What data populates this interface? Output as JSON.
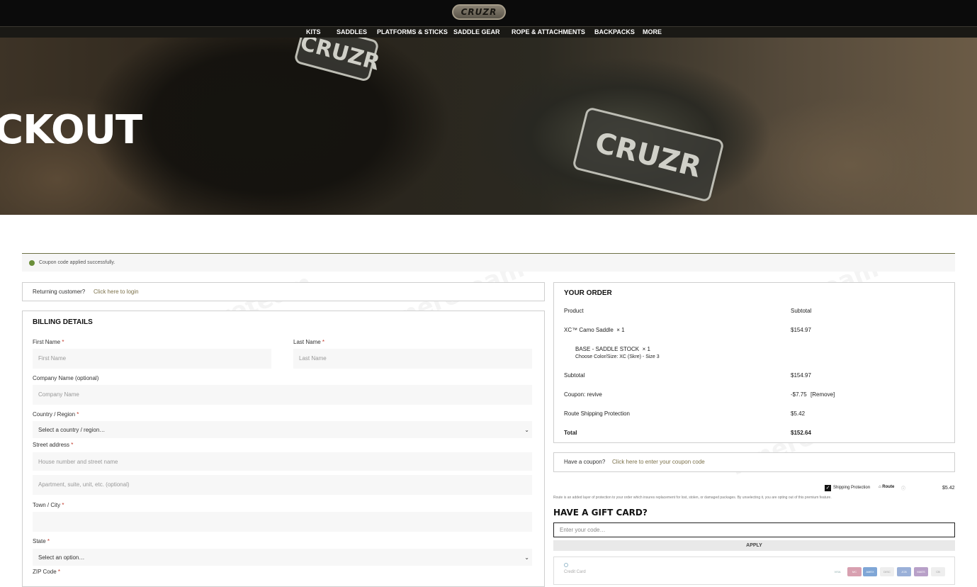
{
  "header": {
    "logo_text": "CRUZR",
    "nav": [
      "KITS",
      "SADDLES",
      "PLATFORMS & STICKS",
      "SADDLE GEAR",
      "ROPE & ATTACHMENTS",
      "BACKPACKS",
      "MORE"
    ]
  },
  "hero": {
    "title": "CKOUT",
    "badge_text": "CRUZR"
  },
  "notice": {
    "text": "Coupon code applied successfully."
  },
  "returning": {
    "text": "Returning customer?",
    "link": "Click here to login"
  },
  "billing": {
    "heading": "BILLING DETAILS",
    "first_name_label": "First Name",
    "first_name_placeholder": "First Name",
    "last_name_label": "Last Name",
    "last_name_placeholder": "Last Name",
    "company_label": "Company Name (optional)",
    "company_placeholder": "Company Name",
    "country_label": "Country / Region",
    "country_value": "Select a country / region…",
    "street_label": "Street address",
    "street_placeholder": "House number and street name",
    "apt_placeholder": "Apartment, suite, unit, etc. (optional)",
    "city_label": "Town / City",
    "state_label": "State",
    "state_value": "Select an option…",
    "zip_label": "ZIP Code",
    "required_mark": "*"
  },
  "order": {
    "heading": "YOUR ORDER",
    "col_product": "Product",
    "col_subtotal": "Subtotal",
    "item_name": "XC™ Camo Saddle",
    "item_qty": "× 1",
    "item_price": "$154.97",
    "sub_item_name": "BASE - SADDLE STOCK",
    "sub_item_qty": "× 1",
    "sub_item_option": "Choose Color/Size: XC (Skre) - Size 3",
    "subtotal_label": "Subtotal",
    "subtotal_value": "$154.97",
    "coupon_label": "Coupon: revive",
    "coupon_value": "-$7.75",
    "coupon_remove": "[Remove]",
    "shipping_label": "Route Shipping Protection",
    "shipping_value": "$5.42",
    "total_label": "Total",
    "total_value": "$152.64"
  },
  "coupon_box": {
    "text": "Have a coupon?",
    "link": "Click here to enter your coupon code"
  },
  "route": {
    "label": "Shipping Protection",
    "brand": "Route",
    "price": "$5.42",
    "disclaimer": "Route is an added layer of protection to your order which insures replacement for lost, stolen, or damaged packages. By unselecting it, you are opting out of this premium feature."
  },
  "gift_card": {
    "title": "HAVE A GIFT CARD?",
    "placeholder": "Enter your code…",
    "apply_label": "APPLY"
  },
  "payment": {
    "method_label": "Credit Card",
    "cards": [
      "VISA",
      "MC",
      "AMEX",
      "DISC",
      "JCB",
      "MAES",
      "CB"
    ]
  },
  "watermark": "Tenereteam",
  "colors": {
    "accent": "#7b7049",
    "dark": "#0b0b0b",
    "required": "#c0392b"
  }
}
